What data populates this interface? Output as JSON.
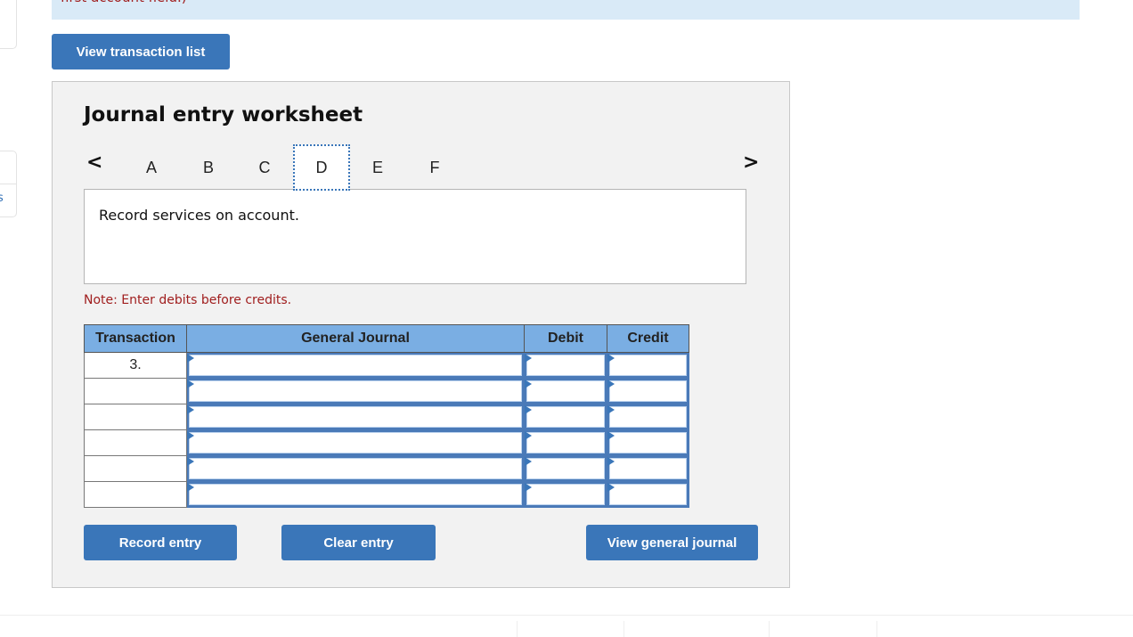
{
  "banner": {
    "text": "first account field.)"
  },
  "side": {
    "partial_label": "s"
  },
  "toolbar": {
    "view_transaction_list": "View transaction list"
  },
  "worksheet": {
    "title": "Journal entry worksheet",
    "nav": {
      "prev_icon": "‹",
      "next_icon": "›"
    },
    "tabs": [
      {
        "label": "A",
        "active": false
      },
      {
        "label": "B",
        "active": false
      },
      {
        "label": "C",
        "active": false
      },
      {
        "label": "D",
        "active": true
      },
      {
        "label": "E",
        "active": false
      },
      {
        "label": "F",
        "active": false
      }
    ],
    "description": "Record services on account.",
    "note": "Note: Enter debits before credits.",
    "table": {
      "headers": [
        "Transaction",
        "General Journal",
        "Debit",
        "Credit"
      ],
      "rows": [
        {
          "transaction": "3.",
          "account": "",
          "debit": "",
          "credit": ""
        },
        {
          "transaction": "",
          "account": "",
          "debit": "",
          "credit": ""
        },
        {
          "transaction": "",
          "account": "",
          "debit": "",
          "credit": ""
        },
        {
          "transaction": "",
          "account": "",
          "debit": "",
          "credit": ""
        },
        {
          "transaction": "",
          "account": "",
          "debit": "",
          "credit": ""
        },
        {
          "transaction": "",
          "account": "",
          "debit": "",
          "credit": ""
        }
      ]
    },
    "buttons": {
      "record": "Record entry",
      "clear": "Clear entry",
      "view_general_journal": "View general journal"
    }
  },
  "colors": {
    "primary_button": "#3a76b9",
    "table_header": "#7aaee3",
    "note_text": "#a01e1e",
    "banner_bg": "#d9eaf7"
  }
}
